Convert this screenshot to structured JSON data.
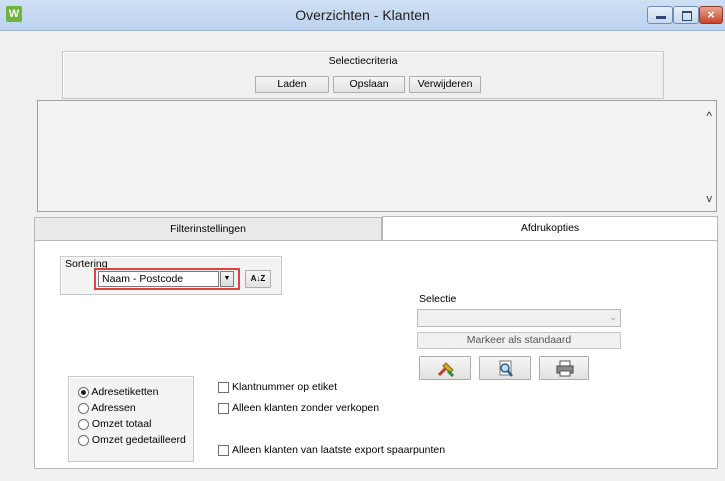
{
  "window": {
    "app_icon_letter": "W",
    "title": "Overzichten - Klanten",
    "controls": {
      "close_glyph": "×"
    }
  },
  "selectiecriteria": {
    "legend": "Selectiecriteria",
    "buttons": {
      "laden": "Laden",
      "opslaan": "Opslaan",
      "verwijderen": "Verwijderen"
    }
  },
  "list": {
    "scroll_up": "^",
    "scroll_down": "v"
  },
  "tabs": [
    {
      "label": "Filterinstellingen",
      "active": false
    },
    {
      "label": "Afdrukopties",
      "active": true
    }
  ],
  "sortering": {
    "legend": "Sortering",
    "selected": "Naam - Postcode",
    "sort_button_glyph": "A↓Z",
    "highlight_color": "#e0433a"
  },
  "selectie": {
    "label": "Selectie",
    "value": "",
    "markeer_button": "Markeer als standaard",
    "icons": [
      "settings-run-icon",
      "preview-icon",
      "print-icon"
    ]
  },
  "layout_options": {
    "selected_index": 0,
    "items": [
      "Adresetiketten",
      "Adressen",
      "Omzet totaal",
      "Omzet gedetailleerd"
    ]
  },
  "checkboxes": [
    {
      "label": "Klantnummer op etiket",
      "checked": false
    },
    {
      "label": "Alleen klanten zonder verkopen",
      "checked": false
    },
    {
      "label": "Alleen klanten van laatste export spaarpunten",
      "checked": false
    }
  ]
}
